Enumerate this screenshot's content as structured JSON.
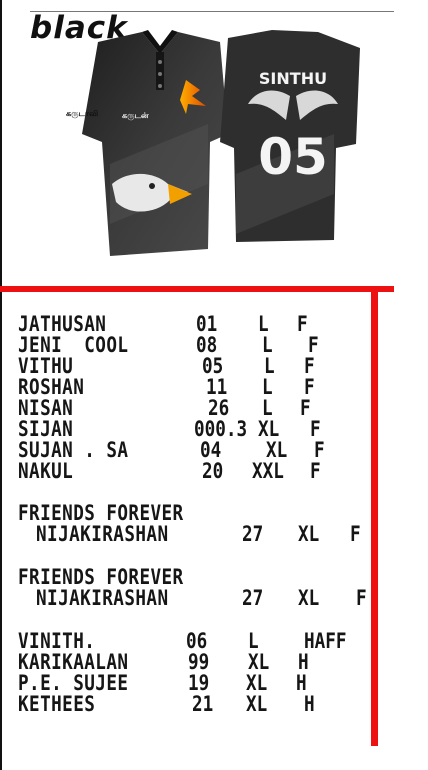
{
  "color_label": "black",
  "jersey": {
    "player_name": "SINTHU",
    "number": "05",
    "sponsor_text_left": "கருடாவி",
    "sponsor_text_mid": "கருடன்"
  },
  "colors": {
    "accent_red": "#e11111",
    "text": "#161616",
    "shirt_dark": "#2b2b2b"
  },
  "roster": {
    "group1": [
      {
        "name": "JATHUSAN",
        "number": "01",
        "size": "L",
        "type": "F"
      },
      {
        "name": "JENI  COOL",
        "number": "08",
        "size": "L",
        "type": "F"
      },
      {
        "name": "VITHU",
        "number": "05",
        "size": "L",
        "type": "F"
      },
      {
        "name": "ROSHAN",
        "number": "11",
        "size": "L",
        "type": "F"
      },
      {
        "name": "NISAN",
        "number": "26",
        "size": "L",
        "type": "F"
      },
      {
        "name": "SIJAN",
        "number": "000.3",
        "size": "XL",
        "type": "F"
      },
      {
        "name": "SUJAN . SA",
        "number": "04",
        "size": "XL",
        "type": "F"
      },
      {
        "name": "NAKUL",
        "number": "20",
        "size": "XXL",
        "type": "F"
      }
    ],
    "group2": {
      "title": "FRIENDS FOREVER",
      "name": "NIJAKIRASHAN",
      "number": "27",
      "size": "XL",
      "type": "F"
    },
    "group3": {
      "title": "FRIENDS FOREVER",
      "name": "NIJAKIRASHAN",
      "number": "27",
      "size": "XL",
      "type": "F"
    },
    "group4": [
      {
        "name": "VINITH.",
        "number": "06",
        "size": "L",
        "type": "HAFF"
      },
      {
        "name": "KARIKAALAN",
        "number": "99",
        "size": "XL",
        "type": "H"
      },
      {
        "name": "P.E. SUJEE",
        "number": "19",
        "size": "XL",
        "type": "H"
      },
      {
        "name": "KETHEES",
        "number": "21",
        "size": "XL",
        "type": "H"
      }
    ]
  }
}
